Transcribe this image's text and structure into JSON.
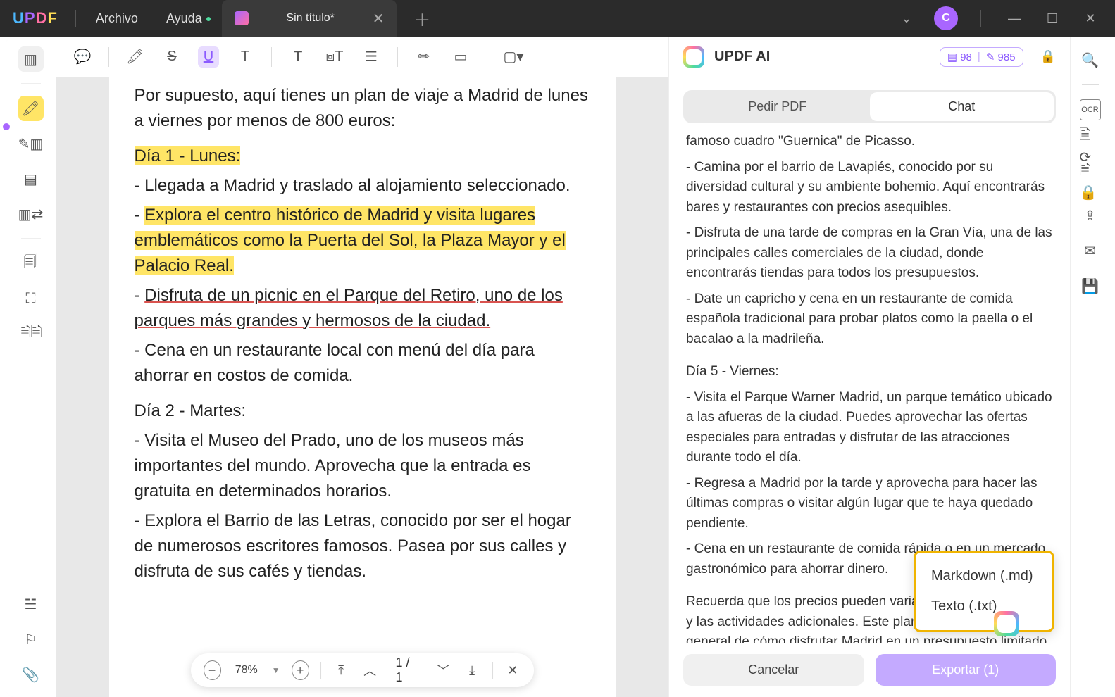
{
  "logo": {
    "l1": "U",
    "l2": "P",
    "l3": "D",
    "l4": "F"
  },
  "menu": {
    "archivo": "Archivo",
    "ayuda": "Ayuda"
  },
  "tab": {
    "title": "Sin título*"
  },
  "avatar": {
    "initial": "C"
  },
  "doc": {
    "intro": "Por supuesto, aquí tienes un plan de viaje a Madrid de lunes a viernes por menos de 800 euros:",
    "d1_title": "Día 1 - Lunes:",
    "d1_l1": "- Llegada a Madrid y traslado al alojamiento seleccionado.",
    "d1_l2_pre": "- ",
    "d1_l2_hl": "Explora el centro histórico de Madrid y visita lugares emblemáticos como la Puerta del Sol, la Plaza Mayor y el Palacio Real.",
    "d1_l3_pre": "- ",
    "d1_l3_ul": "Disfruta de un picnic en el Parque del Retiro, uno de los parques más grandes y hermosos de la ciudad.",
    "d1_l4": "- Cena en un restaurante local con menú del día para ahorrar en costos de comida.",
    "d2_title": "Día 2 - Martes:",
    "d2_l1": "- Visita el Museo del Prado, uno de los museos más importantes del mundo. Aprovecha que la entrada es gratuita en determinados horarios.",
    "d2_l2": "- Explora el Barrio de las Letras, conocido por ser el hogar de numerosos escritores famosos. Pasea por sus calles y disfruta de sus cafés y tiendas."
  },
  "pagebar": {
    "zoom": "78%",
    "page": "1 / 1"
  },
  "ai": {
    "title": "UPDF AI",
    "badge1": "▤ 98",
    "badge2": "✎ 985",
    "tab_pdf": "Pedir PDF",
    "tab_chat": "Chat",
    "c1": "famoso cuadro \"Guernica\" de Picasso.",
    "c2": "- Camina por el barrio de Lavapiés, conocido por su diversidad cultural y su ambiente bohemio. Aquí encontrarás bares y restaurantes con precios asequibles.",
    "c3": "- Disfruta de una tarde de compras en la Gran Vía, una de las principales calles comerciales de la ciudad, donde encontrarás tiendas para todos los presupuestos.",
    "c4": "- Date un capricho y cena en un restaurante de comida española tradicional para probar platos como la paella o el bacalao a la madrileña.",
    "c5": "Día 5 - Viernes:",
    "c6": "- Visita el Parque Warner Madrid, un parque temático ubicado a las afueras de la ciudad. Puedes aprovechar las ofertas especiales para entradas y disfrutar de las atracciones durante todo el día.",
    "c7": "- Regresa a Madrid por la tarde y aprovecha para hacer las últimas compras o visitar algún lugar que te haya quedado pendiente.",
    "c8": "- Cena en un restaurante de comida rápida o en un mercado gastronómico para ahorrar dinero.",
    "c9": "Recuerda que los precios pueden variar según la temporada y las actividades adicionales. Este plan te brinda una idea general de cómo disfrutar Madrid en un presupuesto limitado.",
    "cancel": "Cancelar",
    "export": "Exportar  (1)"
  },
  "export_popup": {
    "md": "Markdown (.md)",
    "txt": "Texto (.txt)"
  }
}
